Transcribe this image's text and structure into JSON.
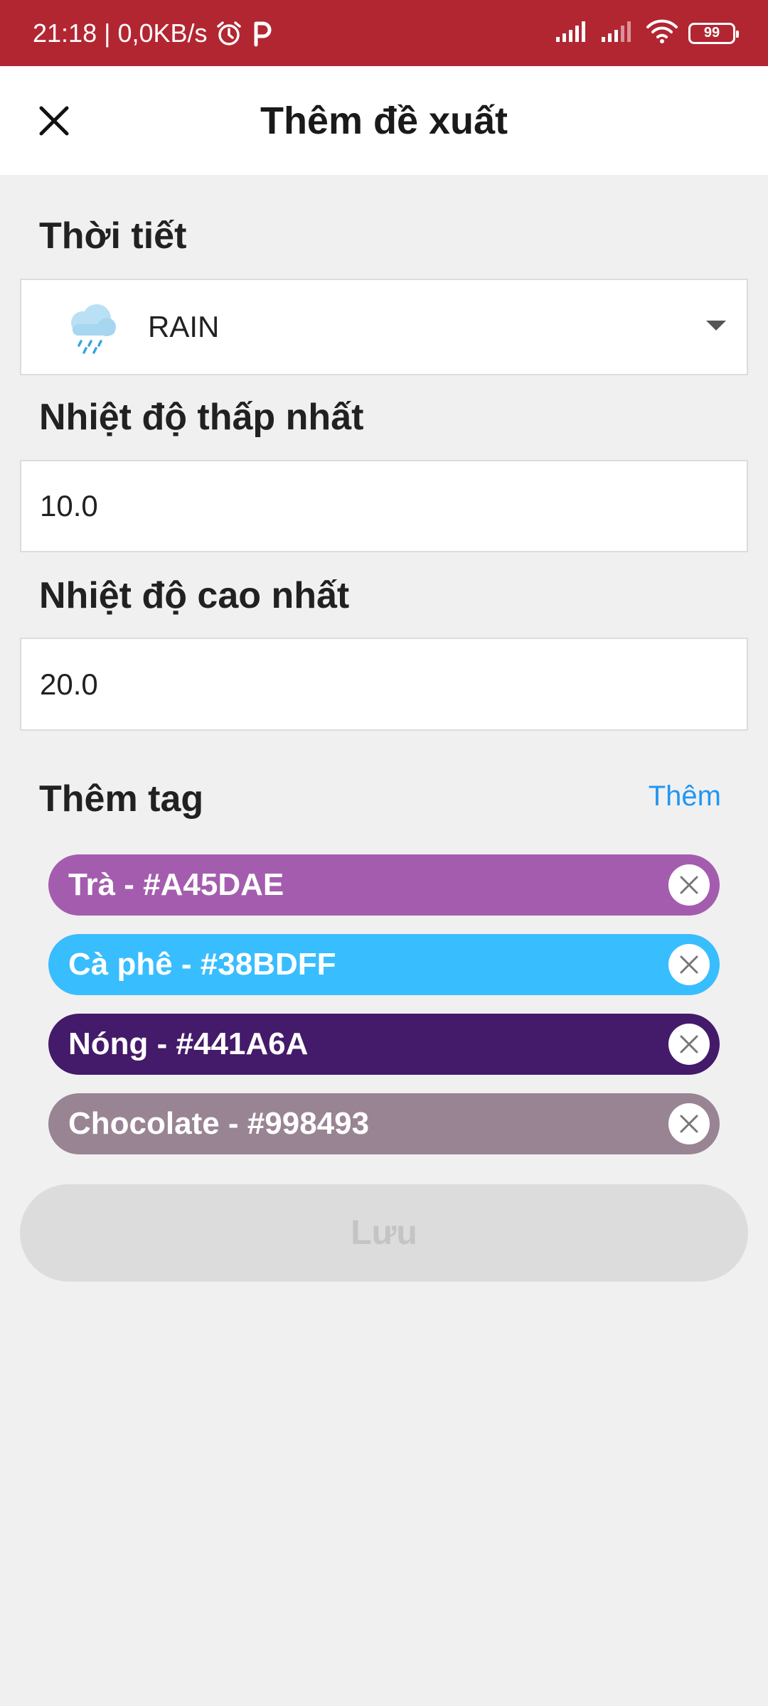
{
  "status_bar": {
    "time_speed": "21:18 | 0,0KB/s",
    "battery": "99"
  },
  "header": {
    "title": "Thêm đề xuất"
  },
  "weather": {
    "label": "Thời tiết",
    "selected": "RAIN",
    "icon": "rain-cloud-icon"
  },
  "min_temp": {
    "label": "Nhiệt độ thấp nhất",
    "value": "10.0"
  },
  "max_temp": {
    "label": "Nhiệt độ cao nhất",
    "value": "20.0"
  },
  "tags": {
    "label": "Thêm tag",
    "add_label": "Thêm",
    "items": [
      {
        "text": "Trà - #A45DAE",
        "color": "#A45DAE"
      },
      {
        "text": "Cà phê - #38BDFF",
        "color": "#38BDFF"
      },
      {
        "text": "Nóng - #441A6A",
        "color": "#441A6A"
      },
      {
        "text": "Chocolate - #998493",
        "color": "#998493"
      }
    ]
  },
  "save_button": {
    "label": "Lưu"
  },
  "colors": {
    "status_bar": "#B22632",
    "link": "#2196F3",
    "disabled_button": "#DCDCDC"
  }
}
